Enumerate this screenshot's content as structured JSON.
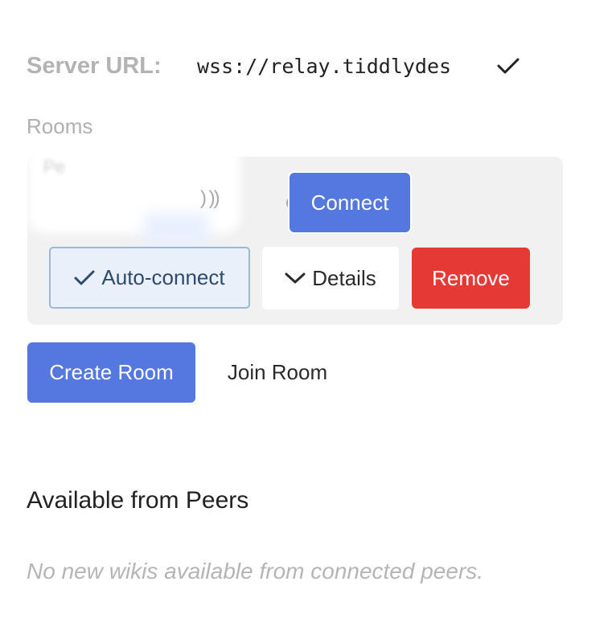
{
  "server": {
    "label": "Server URL:",
    "url_value": "wss://relay.tiddlydes",
    "confirm_icon": "checkmark-icon"
  },
  "rooms": {
    "label": "Rooms",
    "items": [
      {
        "name": "Pe",
        "status": "disconnected",
        "status_color": "#a6a6a6",
        "connect_label": "Connect",
        "autoconnect_label": "Auto-connect",
        "autoconnect_checked": true,
        "details_label": "Details",
        "remove_label": "Remove"
      }
    ],
    "create_label": "Create Room",
    "join_label": "Join Room"
  },
  "peers": {
    "heading": "Available from Peers",
    "empty_message": "No new wikis available from connected peers."
  },
  "colors": {
    "primary": "#5577e0",
    "danger": "#e53935",
    "toggle_bg": "#e9f0fa",
    "muted_text": "#b3b3b3"
  }
}
